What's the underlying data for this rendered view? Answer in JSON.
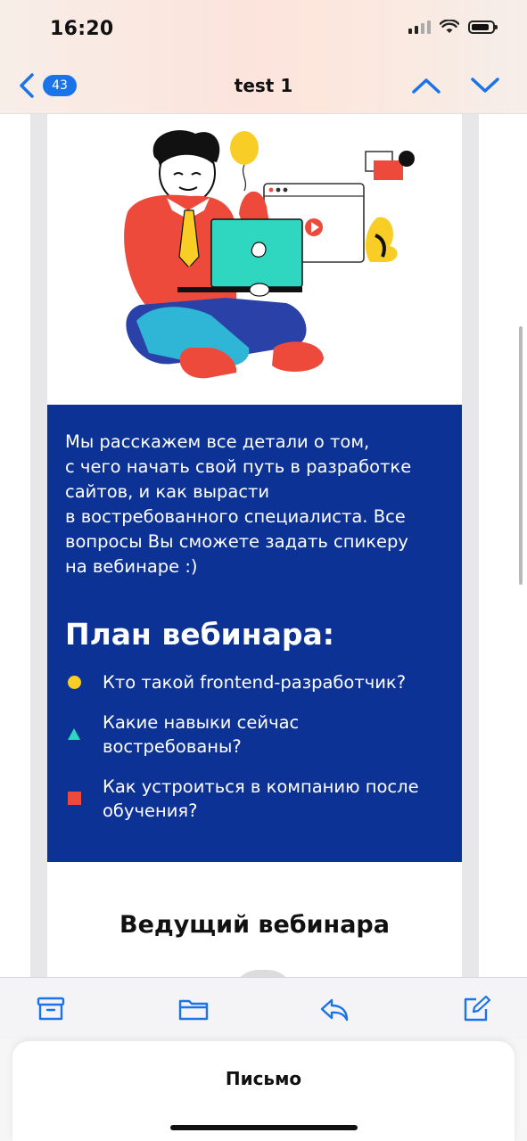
{
  "status": {
    "time": "16:20"
  },
  "nav": {
    "unread_count": "43",
    "title": "test 1"
  },
  "email": {
    "intro": "Мы расскажем все детали о том,\nс чего начать свой путь в разработке\nсайтов, и как вырасти\nв востребованного специалиста. Все\nвопросы Вы сможете задать спикеру\nна вебинаре :)",
    "plan_title": "План вебинара:",
    "plan_items": [
      {
        "text": "Кто такой frontend-разработчик?",
        "bullet": "circle",
        "color": "#f7cd26"
      },
      {
        "text": "Какие навыки сейчас\nвостребованы?",
        "bullet": "triangle",
        "color": "#2fd7c1"
      },
      {
        "text": "Как устроиться в компанию после\nобучения?",
        "bullet": "square",
        "color": "#ee4a3c"
      }
    ],
    "host_title": "Ведущий вебинара",
    "colors": {
      "panel": "#0d3296",
      "accent": "#1a73e8"
    }
  },
  "toolbar": {
    "icons": [
      "archive-icon",
      "folder-icon",
      "reply-icon",
      "compose-icon"
    ]
  },
  "sheet": {
    "title": "Письмо"
  }
}
